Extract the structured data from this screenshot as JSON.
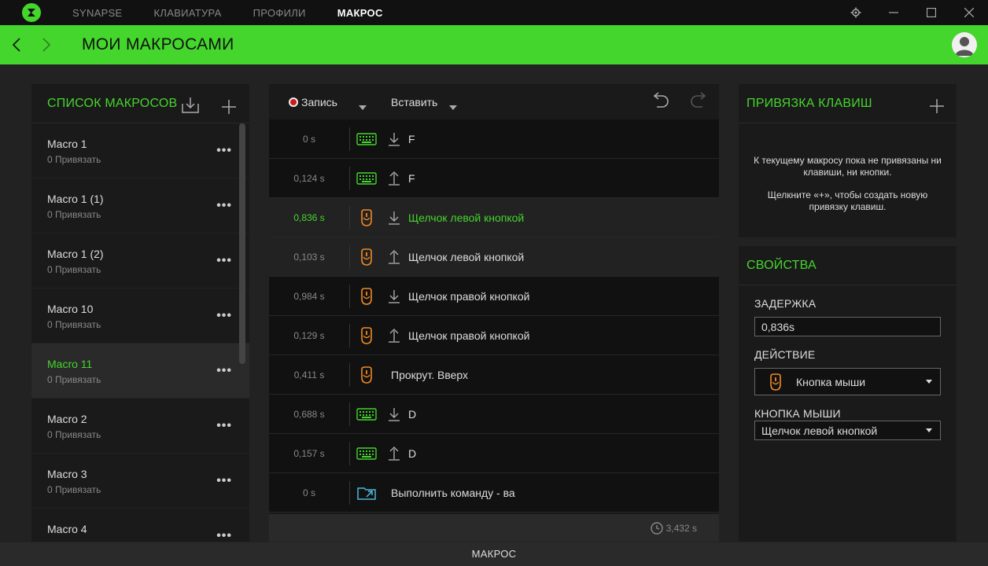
{
  "nav": {
    "tabs": [
      {
        "label": "SYNAPSE"
      },
      {
        "label": "КЛАВИАТУРА"
      },
      {
        "label": "ПРОФИЛИ"
      },
      {
        "label": "МАКРОС"
      }
    ]
  },
  "header": {
    "title": "МОИ МАКРОСАМИ"
  },
  "macro_list": {
    "title": "СПИСОК МАКРОСОВ",
    "items": [
      {
        "name": "Macro 1",
        "sub": "0 Привязать"
      },
      {
        "name": "Macro 1 (1)",
        "sub": "0 Привязать"
      },
      {
        "name": "Macro 1 (2)",
        "sub": "0 Привязать"
      },
      {
        "name": "Macro 10",
        "sub": "0 Привязать"
      },
      {
        "name": "Macro 11",
        "sub": "0 Привязать"
      },
      {
        "name": "Macro 2",
        "sub": "0 Привязать"
      },
      {
        "name": "Macro 3",
        "sub": "0 Привязать"
      },
      {
        "name": "Macro 4",
        "sub": ""
      }
    ]
  },
  "editor": {
    "record_label": "Запись",
    "insert_label": "Вставить",
    "rows": [
      {
        "time": "0 s",
        "action": "F"
      },
      {
        "time": "0,124 s",
        "action": "F"
      },
      {
        "time": "0,836 s",
        "action": "Щелчок левой кнопкой"
      },
      {
        "time": "0,103 s",
        "action": "Щелчок левой кнопкой"
      },
      {
        "time": "0,984 s",
        "action": "Щелчок правой кнопкой"
      },
      {
        "time": "0,129 s",
        "action": "Щелчок правой кнопкой"
      },
      {
        "time": "0,411 s",
        "action": "Прокрут. Вверх"
      },
      {
        "time": "0,688 s",
        "action": "D"
      },
      {
        "time": "0,157 s",
        "action": "D"
      },
      {
        "time": "0 s",
        "action": "Выполнить команду - ва"
      }
    ],
    "total": "3,432 s"
  },
  "bindings": {
    "title": "ПРИВЯЗКА КЛАВИШ",
    "empty_line1": "К текущему макросу пока не привязаны ни клавиши, ни кнопки.",
    "empty_line2": "Щелкните «+», чтобы создать новую привязку клавиш."
  },
  "properties": {
    "title": "СВОЙСТВА",
    "delay_label": "ЗАДЕРЖКА",
    "delay_value": "0,836s",
    "action_label": "ДЕЙСТВИЕ",
    "action_value": "Кнопка мыши",
    "mouse_button_label": "КНОПКА МЫШИ",
    "mouse_button_value": "Щелчок левой кнопкой"
  },
  "footer": {
    "label": "МАКРОС"
  },
  "colors": {
    "accent": "#44d62c",
    "mouse_icon": "#f08a24",
    "keyboard_icon": "#44d62c",
    "command_icon": "#4fb8d8"
  }
}
